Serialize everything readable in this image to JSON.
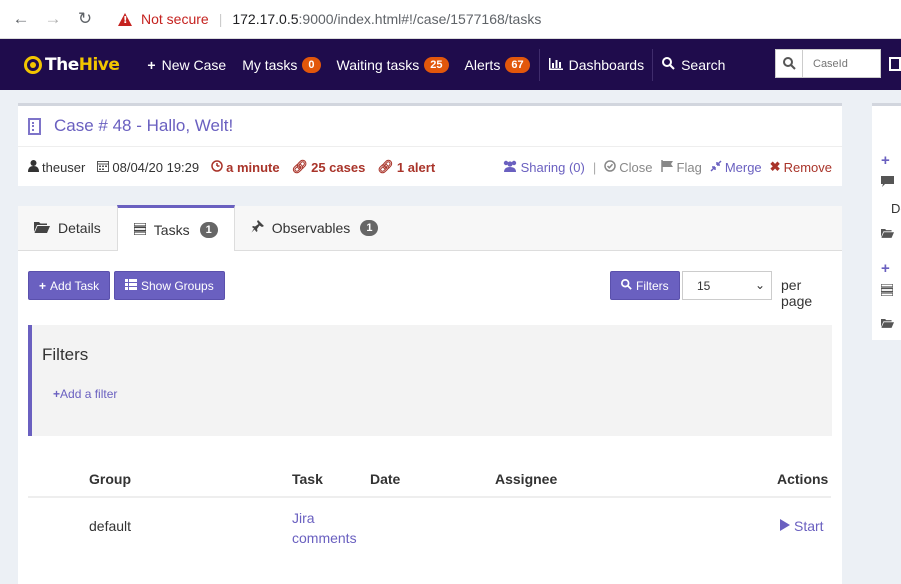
{
  "browser": {
    "not_secure": "Not secure",
    "url_host": "172.17.0.5",
    "url_rest": ":9000/index.html#!/case/1577168/tasks"
  },
  "navbar": {
    "brand_the": "The",
    "brand_hive": "Hive",
    "new_case": "New Case",
    "my_tasks": "My tasks",
    "my_tasks_count": "0",
    "waiting_tasks": "Waiting tasks",
    "waiting_tasks_count": "25",
    "alerts": "Alerts",
    "alerts_count": "67",
    "dashboards": "Dashboards",
    "search": "Search",
    "caseid_placeholder": "CaseId"
  },
  "case": {
    "title": "Case # 48 - Hallo, Welt!",
    "user": "theuser",
    "date": "08/04/20 19:29",
    "age": "a minute",
    "related_cases": "25 cases",
    "related_alerts": "1 alert",
    "actions": {
      "sharing": "Sharing (0)",
      "close": "Close",
      "flag": "Flag",
      "merge": "Merge",
      "remove": "Remove"
    }
  },
  "tabs": [
    {
      "label": "Details"
    },
    {
      "label": "Tasks",
      "count": "1"
    },
    {
      "label": "Observables",
      "count": "1"
    }
  ],
  "toolbar": {
    "add_task": "Add Task",
    "show_groups": "Show Groups",
    "filters": "Filters",
    "page_size": "15",
    "per_page": "per page"
  },
  "filters_panel": {
    "title": "Filters",
    "add_filter": "Add a filter"
  },
  "table": {
    "headers": [
      "Group",
      "Task",
      "Date",
      "Assignee",
      "Actions"
    ],
    "rows": [
      {
        "group": "default",
        "task_line1": "Jira",
        "task_line2": "comments",
        "date": "",
        "assignee": "",
        "action": "Start"
      }
    ]
  },
  "side_panel": {
    "partial_text": "De"
  },
  "colors": {
    "navbar_bg": "#1f0c4c",
    "brand_accent": "#f2c500",
    "primary": "#6a60c0",
    "badge_orange": "#e2570b",
    "danger": "#a9342a"
  }
}
